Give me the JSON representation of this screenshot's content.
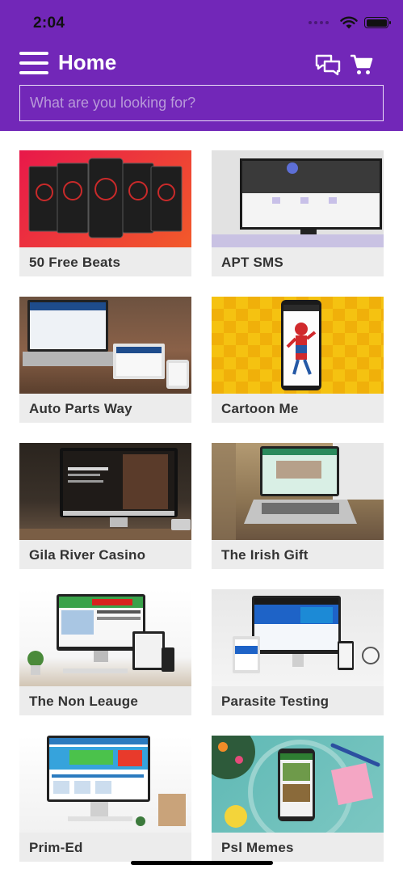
{
  "status": {
    "time": "2:04"
  },
  "header": {
    "title": "Home",
    "search_placeholder": "What are you looking for?",
    "accent": "#7227b8"
  },
  "icons": [
    "menu-icon",
    "chat-icon",
    "cart-icon",
    "wifi-icon",
    "battery-icon"
  ],
  "products": [
    {
      "label": "50 Free Beats"
    },
    {
      "label": "APT SMS"
    },
    {
      "label": "Auto Parts Way"
    },
    {
      "label": "Cartoon Me"
    },
    {
      "label": "Gila River Casino"
    },
    {
      "label": "The Irish Gift"
    },
    {
      "label": "The Non Leauge"
    },
    {
      "label": "Parasite Testing"
    },
    {
      "label": "Prim-Ed"
    },
    {
      "label": "Psl Memes"
    }
  ]
}
